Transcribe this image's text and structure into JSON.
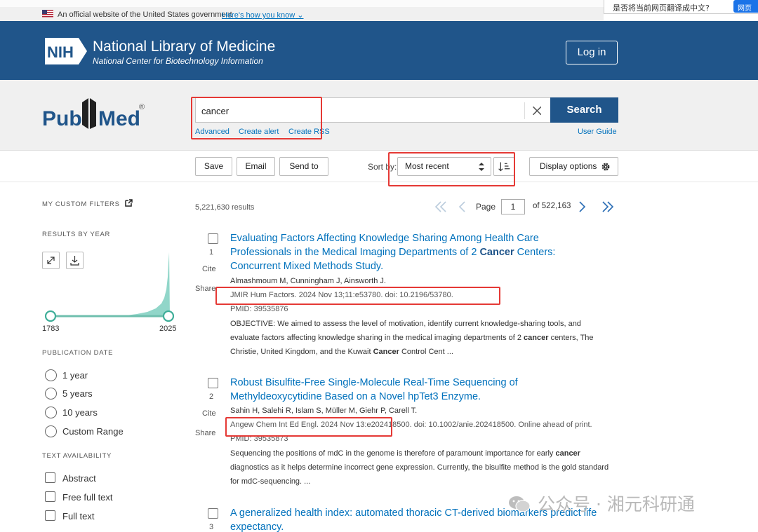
{
  "gov_banner": {
    "text": "An official website of the United States government",
    "link": "Here's how you know"
  },
  "translate_popup": {
    "text": "是否将当前网页翻译成中文?",
    "button": "网页翻"
  },
  "header": {
    "nih_badge": "NIH",
    "title": "National Library of Medicine",
    "subtitle": "National Center for Biotechnology Information",
    "login": "Log in"
  },
  "logo": {
    "text_pub": "Pub",
    "text_med": "Med",
    "reg": "®"
  },
  "search": {
    "query": "cancer",
    "button": "Search",
    "links": [
      "Advanced",
      "Create alert",
      "Create RSS"
    ],
    "user_guide": "User Guide"
  },
  "toolbar": {
    "save": "Save",
    "email": "Email",
    "send_to": "Send to",
    "sort_by_label": "Sort by:",
    "sort_value": "Most recent",
    "display_options": "Display options"
  },
  "sidebar": {
    "custom_filters": "MY CUSTOM FILTERS",
    "results_by_year": "RESULTS BY YEAR",
    "year_start": "1783",
    "year_end": "2025",
    "publication_date": "PUBLICATION DATE",
    "date_options": [
      "1 year",
      "5 years",
      "10 years",
      "Custom Range"
    ],
    "text_availability": "TEXT AVAILABILITY",
    "text_options": [
      "Abstract",
      "Free full text",
      "Full text"
    ]
  },
  "results": {
    "count": "5,221,630 results",
    "page_label": "Page",
    "page_value": "1",
    "page_of": "of 522,163",
    "cite_label": "Cite",
    "share_label": "Share",
    "items": [
      {
        "num": "1",
        "title_a": "Evaluating Factors Affecting Knowledge Sharing Among Health Care Professionals in the Medical Imaging Departments of 2 ",
        "title_b": "Cancer",
        "title_c": " Centers: Concurrent Mixed Methods Study.",
        "authors": "Almashmoum M, Cunningham J, Ainsworth J.",
        "journal": "JMIR Hum Factors. 2024 Nov 13;11:e53780. doi: 10.2196/53780.",
        "pmid": "PMID: 39535876",
        "snippet_a": "OBJECTIVE: We aimed to assess the level of motivation, identify current knowledge-sharing tools, and evaluate factors affecting knowledge sharing in the medical imaging departments of 2 ",
        "snippet_b": "cancer",
        "snippet_c": " centers, The Christie, United Kingdom, and the Kuwait ",
        "snippet_d": "Cancer",
        "snippet_e": " Control Cent ..."
      },
      {
        "num": "2",
        "title_a": "Robust Bisulfite-Free Single-Molecule Real-Time Sequencing of Methyldeoxycytidine Based on a Novel hpTet3 Enzyme.",
        "authors": "Sahin H, Salehi R, Islam S, Müller M, Giehr P, Carell T.",
        "journal": "Angew Chem Int Ed Engl. 2024 Nov 13:e202418500. doi: 10.1002/anie.202418500. Online ahead of print.",
        "pmid": "PMID: 39535873",
        "snippet_a": "Sequencing the positions of mdC in the genome is therefore of paramount importance for early ",
        "snippet_b": "cancer",
        "snippet_c": " diagnostics as it helps determine incorrect gene expression. Currently, the bisulfite method is the gold standard for mdC-sequencing. ..."
      },
      {
        "num": "3",
        "title_a": "A generalized health index: automated thoracic CT-derived biomarkers predict life expectancy."
      }
    ]
  },
  "watermark": "公众号 · 湘元科研通",
  "colors": {
    "nlm_blue": "#20558a",
    "link_blue": "#0071bc",
    "highlight_red": "#e53935",
    "histogram": "#7ecfc0"
  }
}
